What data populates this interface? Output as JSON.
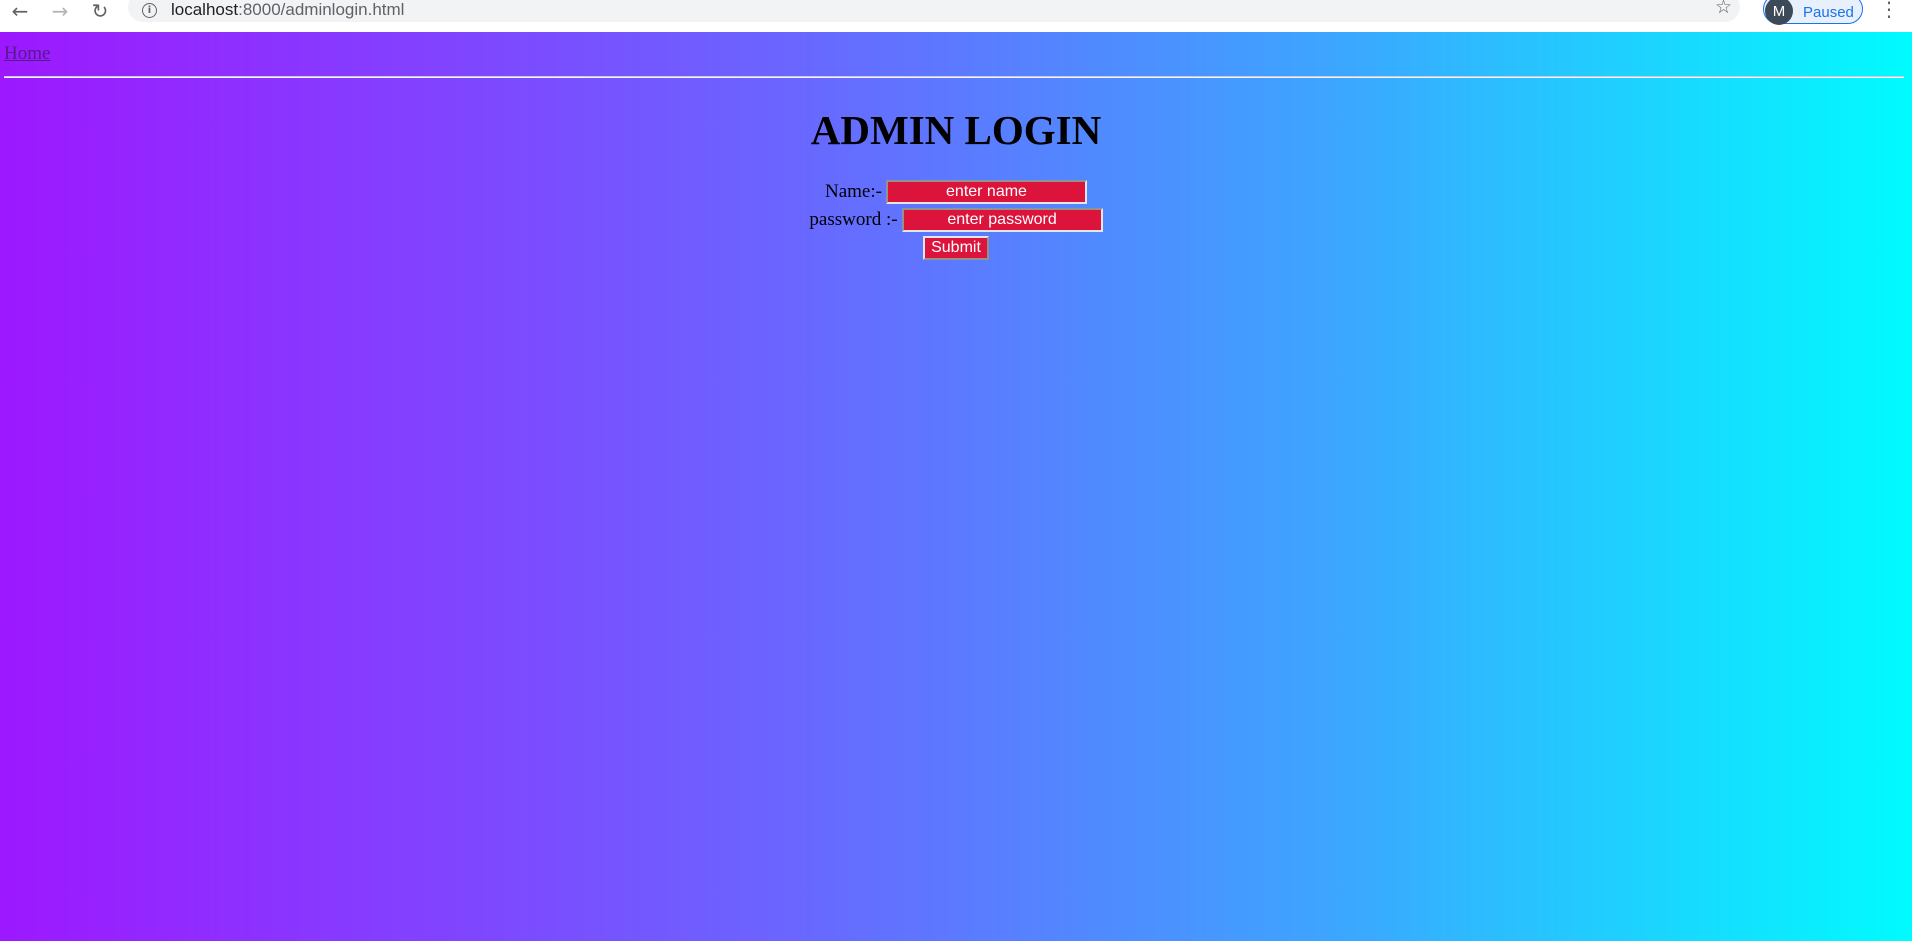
{
  "browser": {
    "url_host": "localhost",
    "url_path": ":8000/adminlogin.html",
    "profile_initial": "M",
    "profile_status": "Paused",
    "icons": {
      "back": "back-arrow-icon",
      "forward": "forward-arrow-icon",
      "reload": "reload-icon",
      "info": "info-icon",
      "bookmark": "star-icon",
      "menu": "kebab-menu-icon"
    }
  },
  "nav": {
    "home_link": "Home"
  },
  "page": {
    "title": "ADMIN LOGIN",
    "gradient_colors": [
      "#9d18ff",
      "#6c63ff",
      "#3ca6ff",
      "#00fbff"
    ]
  },
  "form": {
    "name_label": "Name:-",
    "name_placeholder": "enter name",
    "password_label": "password :-",
    "password_placeholder": "enter password",
    "submit_label": "Submit",
    "field_color": "#dc143c"
  }
}
